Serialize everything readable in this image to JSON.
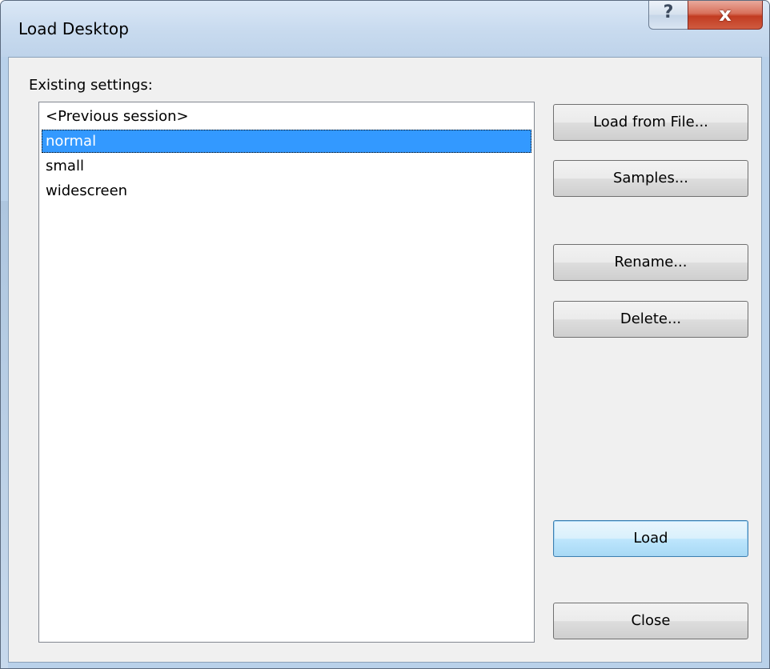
{
  "window": {
    "title": "Load Desktop",
    "help_glyph": "?",
    "close_glyph": "x"
  },
  "settings": {
    "label": "Existing settings:",
    "items": [
      "<Previous session>",
      "normal",
      "small",
      "widescreen"
    ],
    "selected_item": "normal"
  },
  "buttons": {
    "load_from_file": "Load from File...",
    "samples": "Samples...",
    "rename": "Rename...",
    "delete": "Delete...",
    "load": "Load",
    "close": "Close"
  },
  "icons": {
    "help": "question-mark-icon",
    "close": "close-x-icon"
  },
  "colors": {
    "selection": "#3399ff",
    "close_button": "#c23c21",
    "default_button_border": "#3c7fb1"
  }
}
